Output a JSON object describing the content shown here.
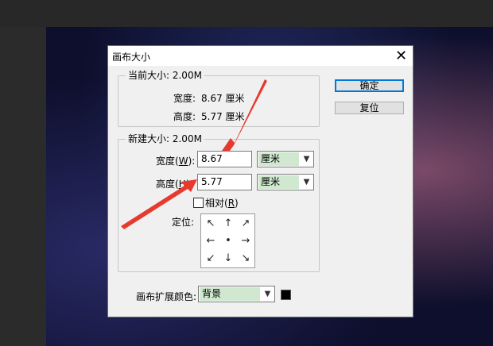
{
  "dialog": {
    "title": "画布大小",
    "close_symbol": "✕",
    "ok_label": "确定",
    "reset_label": "复位"
  },
  "current_size": {
    "legend": "当前大小: 2.00M",
    "width_label": "宽度:",
    "width_value": "8.67 厘米",
    "height_label": "高度:",
    "height_value": "5.77 厘米"
  },
  "new_size": {
    "legend": "新建大小: 2.00M",
    "width_label_prefix": "宽度(",
    "width_hotkey": "W",
    "width_label_suffix": "):",
    "width_value": "8.67",
    "width_unit": "厘米",
    "height_label_prefix": "高度(",
    "height_hotkey": "H",
    "height_label_suffix": "):",
    "height_value": "5.77",
    "height_unit": "厘米",
    "relative_label_prefix": "相对(",
    "relative_hotkey": "R",
    "relative_label_suffix": ")",
    "relative_checked": false,
    "anchor_label": "定位:",
    "anchor_cells": [
      "↖",
      "↑",
      "↗",
      "←",
      "•",
      "→",
      "↙",
      "↓",
      "↘"
    ]
  },
  "extension": {
    "label": "画布扩展颜色:",
    "value": "背景",
    "swatch_color": "#000000"
  },
  "colors": {
    "selection_green": "#cfe8cf",
    "annotation_red": "#e8392e",
    "default_button_border": "#0078d7"
  }
}
